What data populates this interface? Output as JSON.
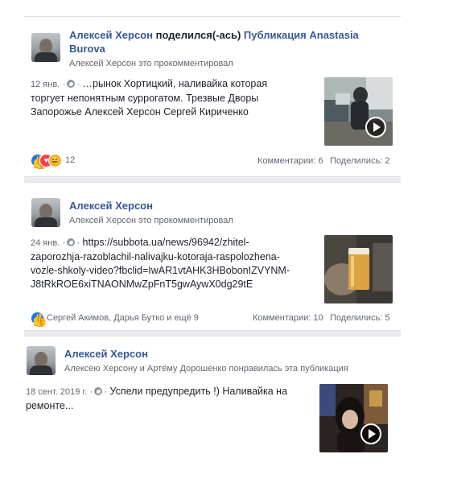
{
  "posts": [
    {
      "author": "Алексей Херсон",
      "action": "поделился(-ась)",
      "target": "Публикация Anastasia",
      "target2": "Burova",
      "subtitle": "Алексей Херсон это прокомментировал",
      "date": "12 янв.",
      "text_line1": "…рынок Хортицкий, наливайка которая",
      "text_line2": "торгует непонятным суррогатом. Трезвые Дворы",
      "text_line3": "Запорожье Алексей Херсон Сергей Кириченко",
      "reaction_count": "12",
      "comments": "Комментарии: 6",
      "shares": "Поделились: 2",
      "thumb_icon": "video-thumbnail",
      "has_play": true
    },
    {
      "author": "Алексей Херсон",
      "subtitle": "Алексей Херсон это прокомментировал",
      "date": "24 янв.",
      "text_line1": "https://subbota.ua/news/96942/zhitel-",
      "text_line2": "zaporozhja-razoblachil-nalivajku-kotoraja-raspolozhena-",
      "text_line3": "vozle-shkoly-video?fbclid=IwAR1vtAHK3HBobonIZVYNM-",
      "text_line4": "J8tRkROE6xiTNAONMwZpFnT5gwAywX0dg29tE",
      "reactors": "Сергей Акимов, Дарья Бутко и ещё 9",
      "comments": "Комментарии: 10",
      "shares": "Поделились: 5"
    },
    {
      "author": "Алексей Херсон",
      "subtitle": "Алексею Херсону и Артёму Дорошенко понравилась эта публикация",
      "date": "18 сент. 2019 г.",
      "text_line1": "Успели предупредить !) Наливайка на",
      "text_line2": "ремонте..."
    }
  ],
  "colors": {
    "link": "#365899",
    "text": "#1d2129",
    "muted": "#606770",
    "like": "#1877f2",
    "love": "#f33e58",
    "haha": "#f7b125"
  }
}
